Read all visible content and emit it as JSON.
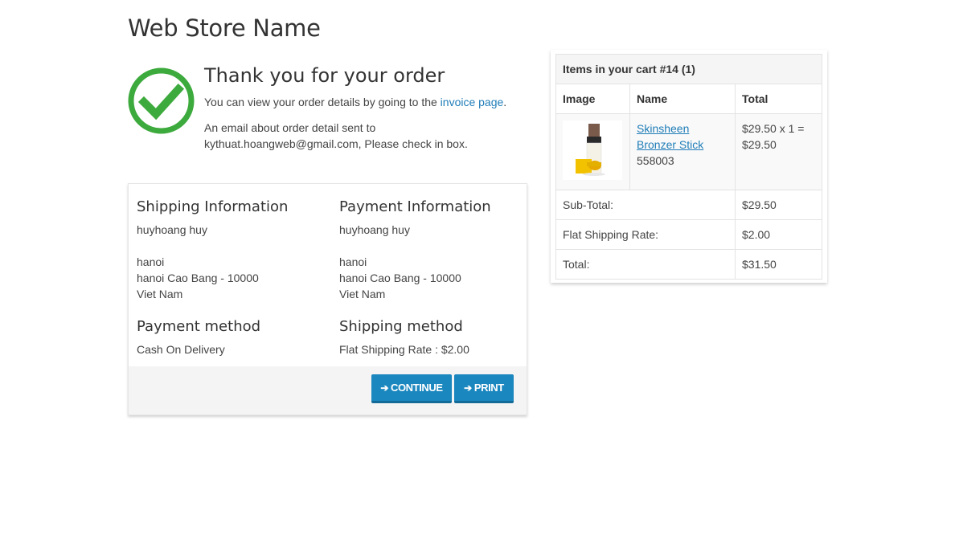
{
  "header": {
    "store_name": "Web Store Name"
  },
  "thanks": {
    "title": "Thank you for your order",
    "view_text_before": "You can view your order details by going to the ",
    "invoice_link": "invoice page",
    "view_text_after": ".",
    "email_line1": "An email about order detail sent to",
    "email_line2": "kythuat.hoangweb@gmail.com, Please check in box."
  },
  "shipping_info": {
    "heading": "Shipping Information",
    "name": "huyhoang huy",
    "city": "hanoi",
    "address": "hanoi Cao Bang - 10000",
    "country": "Viet Nam"
  },
  "payment_info": {
    "heading": "Payment Information",
    "name": "huyhoang huy",
    "city": "hanoi",
    "address": "hanoi Cao Bang - 10000",
    "country": "Viet Nam"
  },
  "payment_method": {
    "heading": "Payment method",
    "value": "Cash On Delivery"
  },
  "shipping_method": {
    "heading": "Shipping method",
    "value": "Flat Shipping Rate : $2.00"
  },
  "buttons": {
    "continue": "CONTINUE",
    "print": "PRINT"
  },
  "cart": {
    "title": "Items in your cart #14 (1)",
    "columns": [
      "Image",
      "Name",
      "Total"
    ],
    "item": {
      "name": "Skinsheen Bronzer Stick",
      "sku": "558003",
      "price_line1": "$29.50 x 1 =",
      "price_line2": "$29.50"
    },
    "subtotal_label": "Sub-Total:",
    "subtotal_value": "$29.50",
    "shipping_label": "Flat Shipping Rate:",
    "shipping_value": "$2.00",
    "total_label": "Total:",
    "total_value": "$31.50"
  },
  "colors": {
    "accent": "#1b87bf",
    "success": "#3daa3d",
    "link": "#1f7db8"
  },
  "icons": {
    "thanks": "checkmark-circle-icon",
    "button_arrow": "arrow-right-icon"
  }
}
